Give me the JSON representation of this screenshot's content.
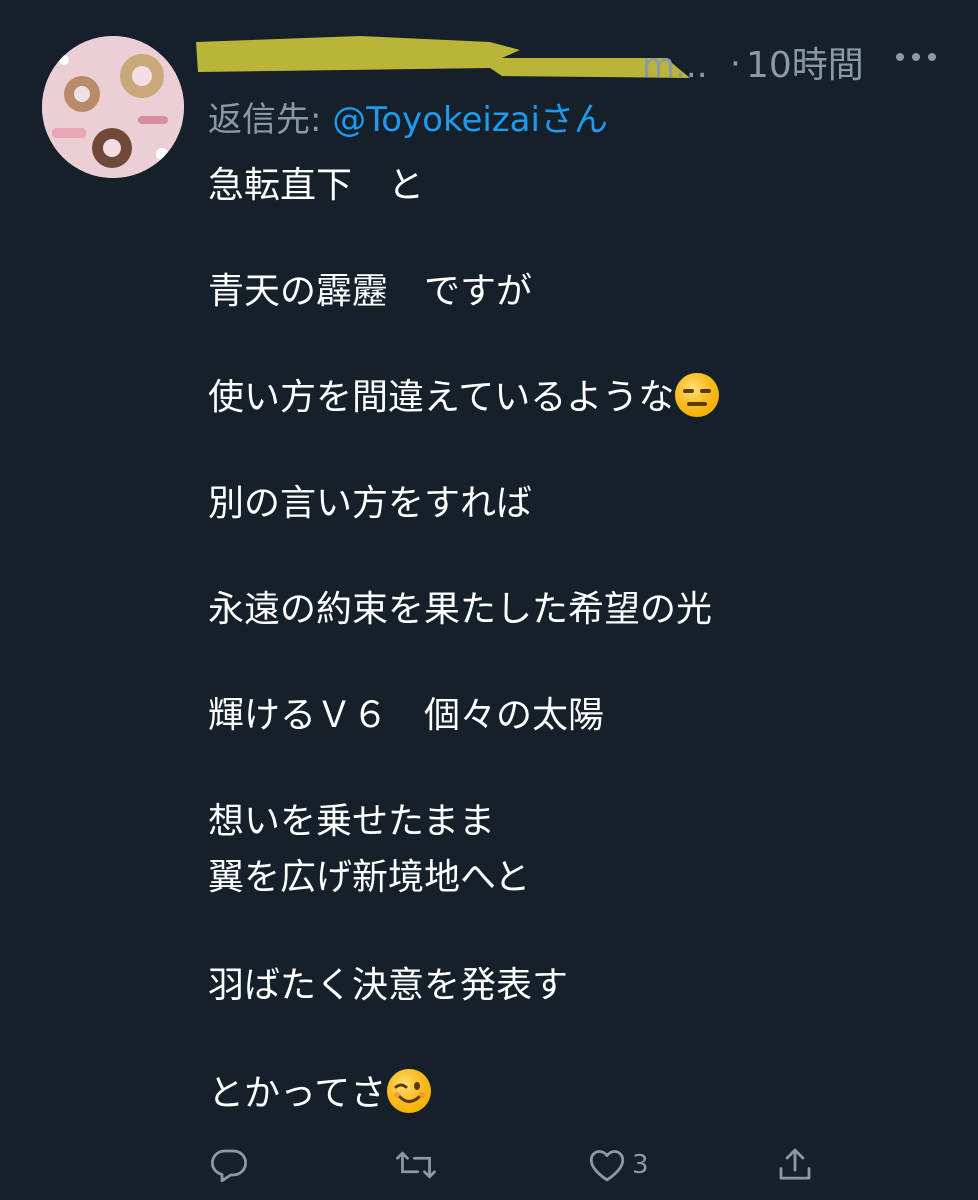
{
  "tweet": {
    "display_name_visible": "m...",
    "separator": "·",
    "time": "10時間",
    "reply_prefix": "返信先: ",
    "reply_handle": "@Toyokeizai",
    "reply_suffix": "さん",
    "body": {
      "l1": "急転直下　と",
      "l2": "青天の霹靂　ですが",
      "l3": "使い方を間違えているような",
      "l3_emoji": "expressionless-face-emoji",
      "l4": "別の言い方をすれば",
      "l5": "永遠の約束を果たした希望の光",
      "l6": "輝けるＶ６　個々の太陽",
      "l7": "想いを乗せたまま",
      "l8": "翼を広げ新境地へと",
      "l9": "羽ばたく決意を発表す",
      "l10": "とかってさ",
      "l10_emoji": "winking-face-emoji"
    }
  },
  "actions": {
    "reply_icon": "reply-icon",
    "retweet_icon": "retweet-icon",
    "like_icon": "heart-icon",
    "like_count": "3",
    "share_icon": "share-icon"
  },
  "colors": {
    "background": "#15202b",
    "text": "#ffffff",
    "secondary": "#8b98a5",
    "link": "#1d9bf0",
    "redaction": "#c9c23a"
  }
}
